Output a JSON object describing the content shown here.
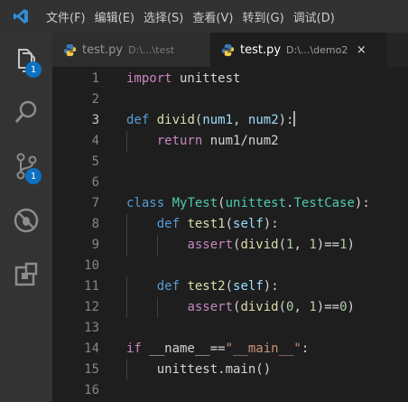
{
  "menu": [
    "文件(F)",
    "编辑(E)",
    "选择(S)",
    "查看(V)",
    "转到(G)",
    "调试(D)"
  ],
  "activity": {
    "explorer_badge": "1",
    "source_control_badge": "1"
  },
  "tabs": [
    {
      "name": "test.py",
      "path": "D:\\...\\test"
    },
    {
      "name": "test.py",
      "path": "D:\\...\\demo2",
      "close": "×"
    }
  ],
  "colors": {
    "keyword": "#569cd6",
    "control_keyword": "#c586c0",
    "function": "#dcdcaa",
    "class": "#4ec9b0",
    "parameter": "#9cdcfe",
    "number": "#b5cea8",
    "string": "#ce9178",
    "badge": "#0e70c0"
  },
  "editor": {
    "line_numbers": [
      "1",
      "2",
      "3",
      "4",
      "5",
      "6",
      "7",
      "8",
      "9",
      "10",
      "11",
      "12",
      "13",
      "14",
      "15",
      "16"
    ],
    "lines": [
      [
        {
          "t": "import",
          "c": "kwc"
        },
        {
          "t": " unittest"
        }
      ],
      [],
      [
        {
          "t": "def",
          "c": "kw"
        },
        {
          "t": " "
        },
        {
          "t": "divid",
          "c": "fn"
        },
        {
          "t": "("
        },
        {
          "t": "num1",
          "c": "pm"
        },
        {
          "t": ", "
        },
        {
          "t": "num2",
          "c": "pm"
        },
        {
          "t": "):"
        }
      ],
      [
        {
          "t": "    "
        },
        {
          "t": "return",
          "c": "kwc"
        },
        {
          "t": " num1/num2"
        }
      ],
      [],
      [],
      [
        {
          "t": "class",
          "c": "kw"
        },
        {
          "t": " "
        },
        {
          "t": "MyTest",
          "c": "cls"
        },
        {
          "t": "("
        },
        {
          "t": "unittest",
          "c": "cls"
        },
        {
          "t": "."
        },
        {
          "t": "TestCase",
          "c": "cls"
        },
        {
          "t": "):"
        }
      ],
      [
        {
          "t": "    "
        },
        {
          "t": "def",
          "c": "kw"
        },
        {
          "t": " "
        },
        {
          "t": "test1",
          "c": "fn"
        },
        {
          "t": "("
        },
        {
          "t": "self",
          "c": "pm"
        },
        {
          "t": "):"
        }
      ],
      [
        {
          "t": "        "
        },
        {
          "t": "assert",
          "c": "kwc"
        },
        {
          "t": "("
        },
        {
          "t": "divid",
          "c": "fn"
        },
        {
          "t": "("
        },
        {
          "t": "1",
          "c": "num"
        },
        {
          "t": ", "
        },
        {
          "t": "1",
          "c": "num"
        },
        {
          "t": ")=="
        },
        {
          "t": "1",
          "c": "num"
        },
        {
          "t": ")"
        }
      ],
      [],
      [
        {
          "t": "    "
        },
        {
          "t": "def",
          "c": "kw"
        },
        {
          "t": " "
        },
        {
          "t": "test2",
          "c": "fn"
        },
        {
          "t": "("
        },
        {
          "t": "self",
          "c": "pm"
        },
        {
          "t": "):"
        }
      ],
      [
        {
          "t": "        "
        },
        {
          "t": "assert",
          "c": "kwc"
        },
        {
          "t": "("
        },
        {
          "t": "divid",
          "c": "fn"
        },
        {
          "t": "("
        },
        {
          "t": "0",
          "c": "num"
        },
        {
          "t": ", "
        },
        {
          "t": "1",
          "c": "num"
        },
        {
          "t": ")=="
        },
        {
          "t": "0",
          "c": "num"
        },
        {
          "t": ")"
        }
      ],
      [],
      [
        {
          "t": "if",
          "c": "kwc"
        },
        {
          "t": " __name__=="
        },
        {
          "t": "\"__main__\"",
          "c": "str"
        },
        {
          "t": ":"
        }
      ],
      [
        {
          "t": "    unittest.main()"
        }
      ],
      []
    ]
  }
}
